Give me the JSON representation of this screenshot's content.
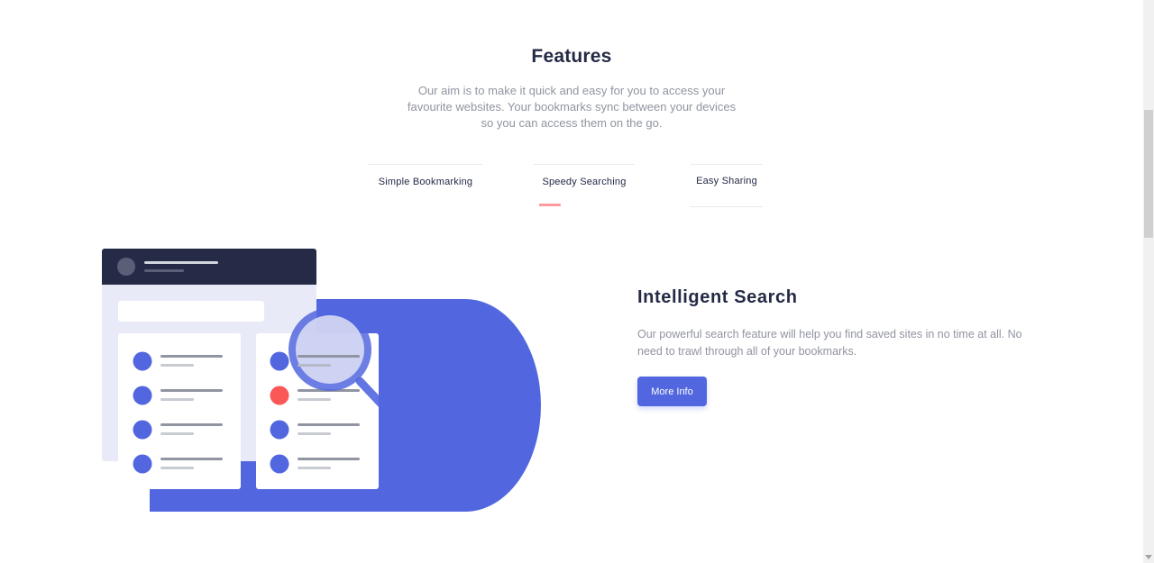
{
  "features": {
    "title": "Features",
    "subtitle": "Our aim is to make it quick and easy for you to access your favourite websites. Your bookmarks sync between your devices so you can access them on the go.",
    "tabs": [
      {
        "label": "Simple Bookmarking",
        "active": false
      },
      {
        "label": "Speedy Searching",
        "active": true
      },
      {
        "label": "Easy Sharing",
        "active": false
      }
    ]
  },
  "panel": {
    "title": "Intelligent Search",
    "text": "Our powerful search feature will help you find saved sites in no time at all. No need to trawl through all of your bookmarks.",
    "button_label": "More Info"
  },
  "colors": {
    "primary": "#5267df",
    "dark_blue": "#242a45",
    "grey_text": "#9194a1",
    "accent_red": "#fa5757",
    "tab_indicator": "#fa9b9d"
  }
}
